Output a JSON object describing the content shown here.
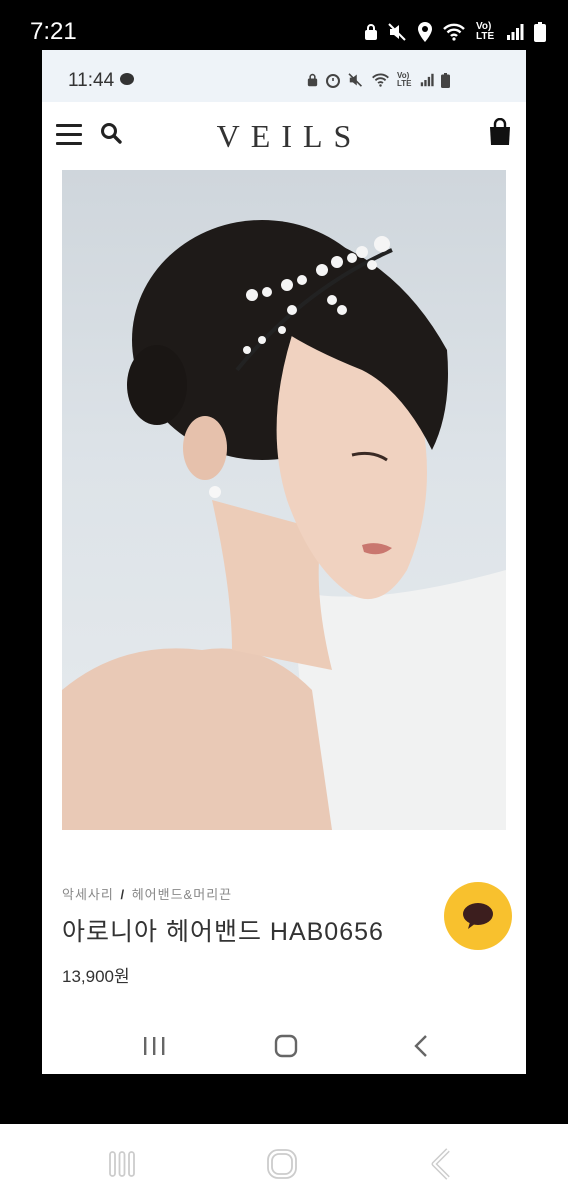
{
  "outer_status": {
    "time": "7:21",
    "icons": [
      "lock-icon",
      "mute-icon",
      "location-icon",
      "wifi-icon",
      "volte-icon",
      "signal-icon",
      "battery-icon"
    ],
    "volte_label": "Vo) LTE"
  },
  "inner_status": {
    "time": "11:44",
    "volte_label": "Vo) LTE"
  },
  "header": {
    "logo": "VEILS"
  },
  "product": {
    "breadcrumb_category": "악세사리",
    "breadcrumb_separator": "/",
    "breadcrumb_subcategory": "헤어밴드&머리끈",
    "title": "아로니아 헤어밴드 HAB0656",
    "price": "13,900원"
  },
  "colors": {
    "kakao_yellow": "#f8c12e",
    "text_dark": "#333333",
    "text_muted": "#888888"
  }
}
